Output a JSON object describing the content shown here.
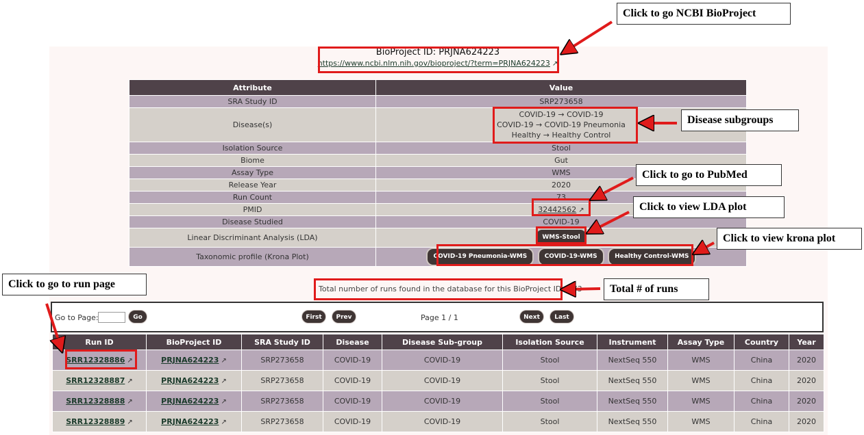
{
  "bioproject": {
    "id_label": "BioProject ID: PRJNA624223",
    "url": "https://www.ncbi.nlm.nih.gov/bioproject/?term=PRJNA624223"
  },
  "attr_table": {
    "headers": [
      "Attribute",
      "Value"
    ],
    "rows": {
      "sra": {
        "label": "SRA Study ID",
        "value": "SRP273658"
      },
      "disease": {
        "label": "Disease(s)",
        "lines": [
          "COVID-19 → COVID-19",
          "COVID-19 → COVID-19 Pneumonia",
          "Healthy → Healthy Control"
        ]
      },
      "isolation": {
        "label": "Isolation Source",
        "value": "Stool"
      },
      "biome": {
        "label": "Biome",
        "value": "Gut"
      },
      "assay": {
        "label": "Assay Type",
        "value": "WMS"
      },
      "release": {
        "label": "Release Year",
        "value": "2020"
      },
      "runcount": {
        "label": "Run Count",
        "value": "73"
      },
      "pmid": {
        "label": "PMID",
        "value": "32442562"
      },
      "disease_studied": {
        "label": "Disease Studied",
        "value": "COVID-19"
      },
      "lda": {
        "label": "Linear Discriminant Analysis (LDA)",
        "button": "WMS-Stool"
      },
      "krona": {
        "label": "Taxonomic profile (Krona Plot)",
        "buttons": [
          "COVID-19 Pneumonia-WMS",
          "COVID-19-WMS",
          "Healthy Control-WMS"
        ]
      }
    }
  },
  "callouts": {
    "ncbi": "Click to go NCBI BioProject",
    "subgroups": "Disease subgroups",
    "pubmed": "Click to go to PubMed",
    "lda": "Click to view LDA plot",
    "krona": "Click to view krona plot",
    "runpage": "Click to go to run page",
    "total": "Total # of runs"
  },
  "total_runs_text": "Total number of runs found in the database for this BioProject ID = 73",
  "pager": {
    "goto_label": "Go to Page:",
    "go": "Go",
    "first": "First",
    "prev": "Prev",
    "page_info": "Page 1 / 1",
    "next": "Next",
    "last": "Last"
  },
  "runs_table": {
    "headers": [
      "Run ID",
      "BioProject ID",
      "SRA Study ID",
      "Disease",
      "Disease Sub-group",
      "Isolation Source",
      "Instrument",
      "Assay Type",
      "Country",
      "Year"
    ],
    "rows": [
      [
        "SRR12328886",
        "PRJNA624223",
        "SRP273658",
        "COVID-19",
        "COVID-19",
        "Stool",
        "NextSeq 550",
        "WMS",
        "China",
        "2020"
      ],
      [
        "SRR12328887",
        "PRJNA624223",
        "SRP273658",
        "COVID-19",
        "COVID-19",
        "Stool",
        "NextSeq 550",
        "WMS",
        "China",
        "2020"
      ],
      [
        "SRR12328888",
        "PRJNA624223",
        "SRP273658",
        "COVID-19",
        "COVID-19",
        "Stool",
        "NextSeq 550",
        "WMS",
        "China",
        "2020"
      ],
      [
        "SRR12328889",
        "PRJNA624223",
        "SRP273658",
        "COVID-19",
        "COVID-19",
        "Stool",
        "NextSeq 550",
        "WMS",
        "China",
        "2020"
      ]
    ]
  },
  "colors": {
    "header": "#4f4249",
    "row_odd": "#b7a8b8",
    "row_even": "#d5d0ca",
    "annotation": "#e01b1b"
  },
  "icons": {
    "external_link": "external-link-icon",
    "arrow": "red-arrow"
  }
}
